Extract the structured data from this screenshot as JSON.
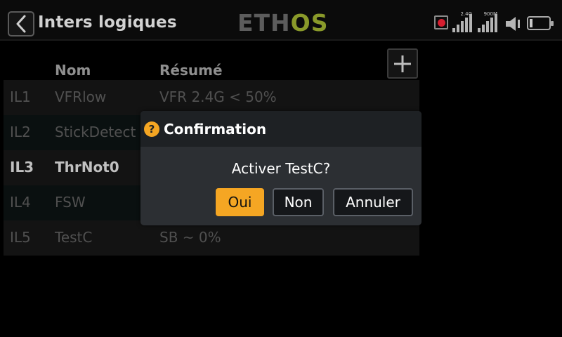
{
  "header": {
    "title": "Inters logiques",
    "logo_left": "ETH",
    "logo_right": "OS",
    "signal1_label": "2.4G",
    "signal2_label": "900M"
  },
  "table": {
    "headers": {
      "name": "Nom",
      "summary": "Résumé"
    },
    "rows": [
      {
        "id": "IL1",
        "name": "VFRlow",
        "summary": "VFR 2.4G < 50%"
      },
      {
        "id": "IL2",
        "name": "StickDetect",
        "summary": ""
      },
      {
        "id": "IL3",
        "name": "ThrNot0",
        "summary": ""
      },
      {
        "id": "IL4",
        "name": "FSW",
        "summary": ""
      },
      {
        "id": "IL5",
        "name": "TestC",
        "summary": "SB ~ 0%"
      }
    ]
  },
  "dialog": {
    "title": "Confirmation",
    "icon": "?",
    "message": "Activer TestC?",
    "yes_label": "Oui",
    "no_label": "Non",
    "cancel_label": "Annuler"
  },
  "colors": {
    "accent": "#f5a623",
    "logo_green": "#8a9a2a",
    "record_red": "#d61e30"
  }
}
